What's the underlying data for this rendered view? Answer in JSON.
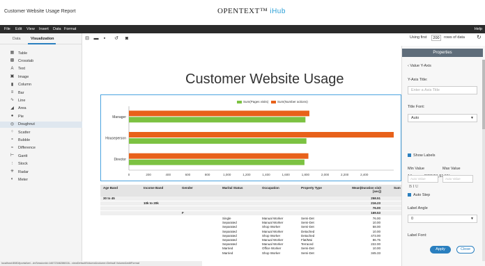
{
  "app_title": "Customer Website Usage Report",
  "brand": {
    "main": "OPENTEXT™",
    "sub": "iHub"
  },
  "menu": {
    "items": [
      "File",
      "Edit",
      "View",
      "Insert",
      "Data",
      "Format"
    ],
    "help": "Help"
  },
  "left_panel": {
    "tabs": [
      "Data",
      "Visualization"
    ],
    "items": [
      {
        "label": "Table",
        "icon": "table-icon",
        "glyph": "▦"
      },
      {
        "label": "Crosstab",
        "icon": "crosstab-icon",
        "glyph": "▩"
      },
      {
        "label": "Text",
        "icon": "text-icon",
        "glyph": "A"
      },
      {
        "label": "Image",
        "icon": "image-icon",
        "glyph": "▣"
      },
      {
        "label": "Column",
        "icon": "column-chart-icon",
        "glyph": "▮"
      },
      {
        "label": "Bar",
        "icon": "bar-chart-icon",
        "glyph": "≡"
      },
      {
        "label": "Line",
        "icon": "line-chart-icon",
        "glyph": "∿"
      },
      {
        "label": "Area",
        "icon": "area-chart-icon",
        "glyph": "◢"
      },
      {
        "label": "Pie",
        "icon": "pie-chart-icon",
        "glyph": "●"
      },
      {
        "label": "Doughnut",
        "icon": "doughnut-chart-icon",
        "glyph": "◎"
      },
      {
        "label": "Scatter",
        "icon": "scatter-chart-icon",
        "glyph": "⁘"
      },
      {
        "label": "Bubble",
        "icon": "bubble-chart-icon",
        "glyph": "∘"
      },
      {
        "label": "Difference",
        "icon": "difference-chart-icon",
        "glyph": "≈"
      },
      {
        "label": "Gantt",
        "icon": "gantt-chart-icon",
        "glyph": "⊢"
      },
      {
        "label": "Stock",
        "icon": "stock-chart-icon",
        "glyph": "⫶"
      },
      {
        "label": "Radar",
        "icon": "radar-chart-icon",
        "glyph": "✳"
      },
      {
        "label": "Meter",
        "icon": "meter-chart-icon",
        "glyph": "◐"
      }
    ],
    "selected": "Doughnut"
  },
  "toolbar": {
    "using_first": "Using first",
    "rows_value": "200",
    "rows_suffix": "rows of data"
  },
  "report": {
    "title": "Customer Website Usage"
  },
  "chart_data": {
    "type": "bar",
    "orientation": "horizontal",
    "categories": [
      "Manager",
      "Houseperson",
      "Director"
    ],
    "series": [
      {
        "name": "Sum(Pages visits)",
        "color": "#7cc242",
        "values": [
          1800,
          1810,
          1790
        ]
      },
      {
        "name": "Sum(Number actions)",
        "color": "#e8611a",
        "values": [
          1840,
          2700,
          1830
        ]
      }
    ],
    "x_ticks": [
      "0",
      "200",
      "400",
      "600",
      "800",
      "1,000",
      "1,200",
      "1,400",
      "1,600",
      "1,800",
      "2,000",
      "2,200",
      "2,400"
    ],
    "xlim": [
      0,
      2700
    ],
    "legend_position": "top-center"
  },
  "table": {
    "headers": [
      "Age Band",
      "Income Band",
      "Gender",
      "Marital Status",
      "Occupation",
      "Property Type",
      "Mean(Duration visit [sec])",
      "Sum"
    ],
    "band_rows": [
      {
        "age": "30 to 45",
        "income": "",
        "value": "258.51"
      },
      {
        "age": "",
        "income": "10k to 20k",
        "value": "216.23"
      }
    ],
    "extra_values": [
      "76.00",
      "169.53"
    ],
    "gender_value": "F",
    "rows": [
      {
        "marital": "Single",
        "occupation": "Manual Worker",
        "property": "Semi-Det",
        "value": "76.00"
      },
      {
        "marital": "Separated",
        "occupation": "Manual Worker",
        "property": "Semi-Det",
        "value": "10.00"
      },
      {
        "marital": "Separated",
        "occupation": "Shop Worker",
        "property": "Semi-Det",
        "value": "58.00"
      },
      {
        "marital": "Separated",
        "occupation": "Manual Worker",
        "property": "Detached",
        "value": "10.00"
      },
      {
        "marital": "Separated",
        "occupation": "Shop Worker",
        "property": "Detached",
        "value": "473.00"
      },
      {
        "marital": "Separated",
        "occupation": "Manual Worker",
        "property": "Flat/Mai",
        "value": "86.75"
      },
      {
        "marital": "Separated",
        "occupation": "Manual Worker",
        "property": "Terraced",
        "value": "222.00"
      },
      {
        "marital": "Married",
        "occupation": "Office Worker",
        "property": "Semi-Det",
        "value": "10.00"
      },
      {
        "marital": "Married",
        "occupation": "Shop Worker",
        "property": "Semi-Det",
        "value": "345.33"
      }
    ]
  },
  "status_url": "localhost:8080/iportal/wr/...dvSessionId=1467234628602&...viewDefault/Volume&volume=Default Volume&editFormat",
  "properties": {
    "title": "Properties",
    "back_label": "Value Y-Axis",
    "yaxis_title_label": "Y-Axis Title:",
    "yaxis_title_placeholder": "Enter a Axis Title",
    "title_font_label": "Title Font:",
    "title_font_value": "Auto",
    "font_size": "14",
    "font_color": "RGB(51,51,51)",
    "biu": "B  I  U",
    "show_labels": "Show Labels",
    "min_label": "Min Value",
    "max_label": "Max Value",
    "min_placeholder": "Auto Value",
    "max_placeholder": "Auto Value",
    "auto_step": "Auto Step",
    "label_angle_label": "Label Angle",
    "label_angle_value": "0",
    "label_font_label": "Label Font:",
    "apply": "Apply",
    "close": "Close"
  }
}
